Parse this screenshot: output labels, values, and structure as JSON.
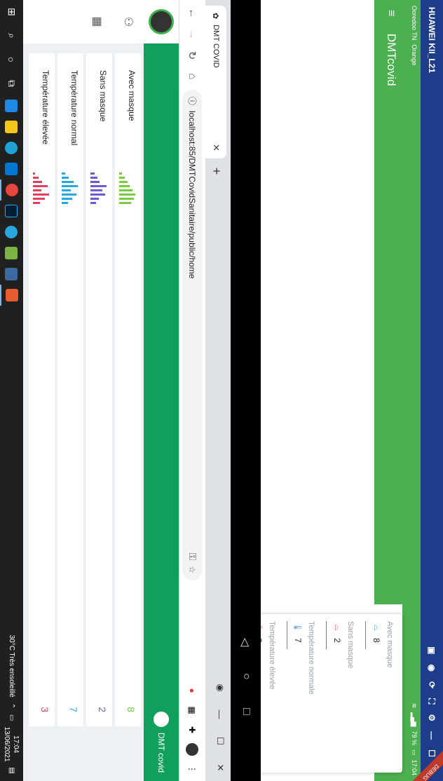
{
  "phone": {
    "device_title": "HUAWEI KII_L21",
    "status": {
      "carrier1": "Ooredoo TN",
      "carrier2": "Orange",
      "battery": "79 %",
      "time": "17:04"
    },
    "debug_label": "DEBUG",
    "app_title": "DMTcovid",
    "stats": [
      {
        "label": "Avec masque",
        "value": "8",
        "icon": "mask-icon",
        "color": "#4a90d9"
      },
      {
        "label": "Sans masque",
        "value": "2",
        "icon": "no-mask-icon",
        "color": "#e05050"
      },
      {
        "label": "Température normale",
        "value": "7",
        "icon": "thermometer-icon",
        "color": "#4a90d9"
      },
      {
        "label": "Température élevée",
        "value": "3",
        "icon": "thermometer-hot-icon",
        "color": "#e05050"
      }
    ]
  },
  "browser": {
    "tab_title": "DMT COVID",
    "url": "localhost:85/DMTCovidSanitaire/public/home"
  },
  "webapp": {
    "brand": "DMT covid",
    "cards": [
      {
        "title": "Avec masque",
        "value": "8",
        "color": "#7ac943",
        "spark": [
          4,
          8,
          12,
          16,
          20,
          24,
          22,
          18
        ]
      },
      {
        "title": "Sans masque",
        "value": "2",
        "color": "#6b5bd6",
        "spark": [
          6,
          10,
          14,
          24,
          18,
          22,
          12,
          8
        ]
      },
      {
        "title": "Température normal",
        "value": "7",
        "color": "#29a8e0",
        "spark": [
          5,
          10,
          18,
          24,
          14,
          22,
          16,
          9
        ]
      },
      {
        "title": "Température élevée",
        "value": "3",
        "color": "#e04060",
        "spark": [
          3,
          8,
          14,
          22,
          12,
          24,
          18,
          10
        ]
      }
    ]
  },
  "taskbar": {
    "weather": "30°C  Très ensoleillé",
    "time": "17:04",
    "date": "13/06/2021"
  }
}
